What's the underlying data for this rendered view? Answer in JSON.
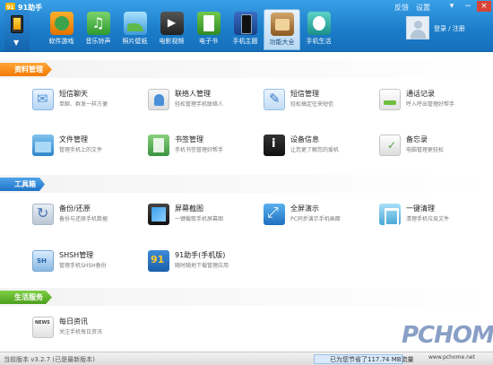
{
  "window": {
    "title": "91助手",
    "links": [
      "反馈",
      "设置"
    ],
    "controls": {
      "minimize": "▾",
      "maximize": "−",
      "close": "×"
    }
  },
  "user": {
    "login": "登录 / 注册"
  },
  "nav": [
    {
      "label": "软件游戏",
      "icon": "games-icon"
    },
    {
      "label": "音乐铃声",
      "icon": "ringtone-icon"
    },
    {
      "label": "照片壁纸",
      "icon": "wallpaper-icon"
    },
    {
      "label": "电影视频",
      "icon": "video-icon"
    },
    {
      "label": "电子书",
      "icon": "ebook-icon"
    },
    {
      "label": "手机主题",
      "icon": "theme-icon"
    },
    {
      "label": "功能大全",
      "icon": "functions-icon",
      "active": true
    },
    {
      "label": "手机生活",
      "icon": "life-icon"
    }
  ],
  "sections": [
    {
      "title": "资料管理",
      "items": [
        {
          "name": "短信聊天",
          "desc": "单聊、群发一样方便"
        },
        {
          "name": "联络人管理",
          "desc": "轻松管理手机联络人"
        },
        {
          "name": "短信管理",
          "desc": "轻松搞定往来短信"
        },
        {
          "name": "通话记录",
          "desc": "呼入呼出管理好帮手"
        },
        {
          "name": "文件管理",
          "desc": "管理手机上的文件"
        },
        {
          "name": "书签管理",
          "desc": "手机书签管理好帮手"
        },
        {
          "name": "设备信息",
          "desc": "让您更了解您的爱机"
        },
        {
          "name": "备忘录",
          "desc": "电脑管理更轻松"
        }
      ]
    },
    {
      "title": "工具箱",
      "items": [
        {
          "name": "备份/还原",
          "desc": "备份与还原手机数据"
        },
        {
          "name": "屏幕截图",
          "desc": "一键截取手机屏幕图"
        },
        {
          "name": "全屏演示",
          "desc": "PC同步演示手机画面"
        },
        {
          "name": "一键清理",
          "desc": "清理手机垃圾文件"
        },
        {
          "name": "SHSH管理",
          "desc": "管理手机SHSH备份"
        },
        {
          "name": "91助手(手机版)",
          "desc": "随时随地下载管理应用"
        }
      ]
    },
    {
      "title": "生活服务",
      "items": [
        {
          "name": "每日资讯",
          "desc": "关注手机每日资讯"
        }
      ]
    }
  ],
  "status": {
    "version": "当前版本 v3.2.7 (已是最新版本)",
    "saved": "已为您节省了117.74 MB流量"
  },
  "watermark": {
    "brand": "PCHOME",
    "url": "www.pchome.net"
  }
}
